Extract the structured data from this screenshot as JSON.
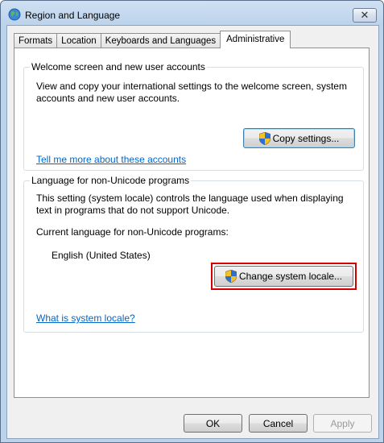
{
  "window": {
    "title": "Region and Language",
    "close_label": "✕"
  },
  "tabs": [
    {
      "label": "Formats"
    },
    {
      "label": "Location"
    },
    {
      "label": "Keyboards and Languages"
    },
    {
      "label": "Administrative"
    }
  ],
  "welcome_group": {
    "title": "Welcome screen and new user accounts",
    "description_1": "View and copy your international settings to the welcome screen, system",
    "description_2": "accounts and new user accounts.",
    "copy_button": "Copy settings...",
    "link": "Tell me more about these accounts"
  },
  "locale_group": {
    "title": "Language for non-Unicode programs",
    "description_1": "This setting (system locale) controls the language used when displaying",
    "description_2": "text in programs that do not support Unicode.",
    "current_label": "Current language for non-Unicode programs:",
    "current_value": "English (United States)",
    "change_button": "Change system locale...",
    "link": "What is system locale?"
  },
  "footer": {
    "ok": "OK",
    "cancel": "Cancel",
    "apply": "Apply"
  },
  "colors": {
    "highlight": "#d40000",
    "link": "#0066cc"
  }
}
